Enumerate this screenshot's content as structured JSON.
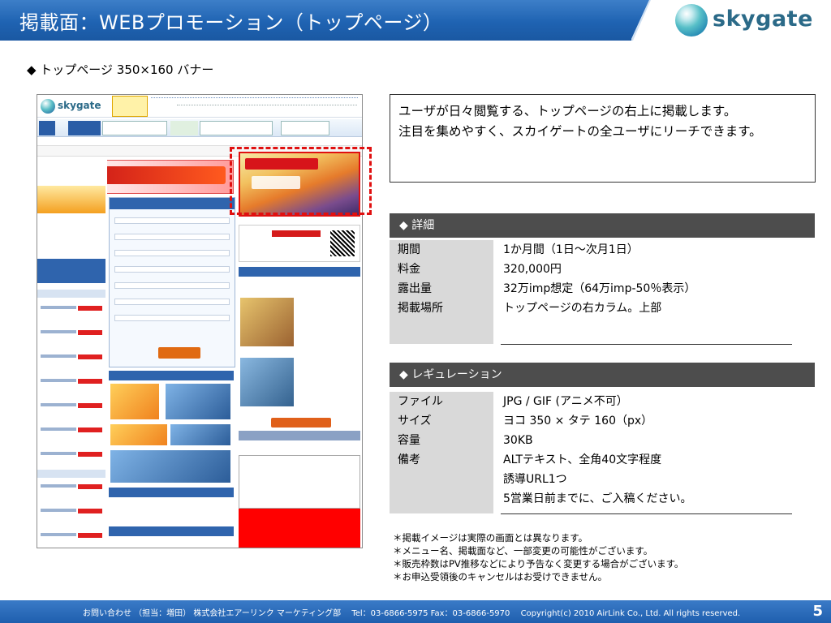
{
  "header": {
    "title": "掲載面：WEBプロモーション（トップページ）",
    "logo_text": "skygate"
  },
  "subtitle": "◆ トップページ 350×160 バナー",
  "description": {
    "line1": "ユーザが日々閲覧する、トップページの右上に掲載します。",
    "line2": "注目を集めやすく、スカイゲートの全ユーザにリーチできます。"
  },
  "details": {
    "header": "◆ 詳細",
    "rows": [
      {
        "label": "期間",
        "value": "1か月間（1日～次月1日）"
      },
      {
        "label": "料金",
        "value": "320,000円"
      },
      {
        "label": "露出量",
        "value": "32万imp想定（64万imp-50％表示）"
      },
      {
        "label": "掲載場所",
        "value": "トップページの右カラム。上部"
      }
    ]
  },
  "regulation": {
    "header": "◆ レギュレーション",
    "rows": [
      {
        "label": "ファイル",
        "value": "JPG / GIF (アニメ不可）"
      },
      {
        "label": "サイズ",
        "value": "ヨコ 350 × タテ 160（px）"
      },
      {
        "label": "容量",
        "value": "30KB"
      },
      {
        "label": "備考",
        "value": "ALTテキスト、全角40文字程度"
      },
      {
        "label": "",
        "value": "誘導URL1つ"
      },
      {
        "label": "",
        "value": "5営業日前までに、ご入稿ください。"
      }
    ]
  },
  "notes": [
    "＊掲載イメージは実際の画面とは異なります。",
    "＊メニュー名、掲載面など、一部変更の可能性がございます。",
    "＊販売枠数はPV推移などにより予告なく変更する場合がございます。",
    "＊お申込受領後のキャンセルはお受けできません。"
  ],
  "footer": {
    "text": "お問い合わせ （担当：増田） 株式会社エアーリンク マーケティング部　 Tel：03-6866-5975 Fax：03-6866-5970　 Copyright(c) 2010 AirLink Co., Ltd. All rights reserved.",
    "page_number": "5"
  },
  "screenshot_mock": {
    "logo_text": "skygate"
  },
  "colors": {
    "header_blue": "#1f63b2",
    "section_bar": "#4d4d4d",
    "label_bg": "#d9d9d9",
    "highlight_red": "#e01010"
  }
}
